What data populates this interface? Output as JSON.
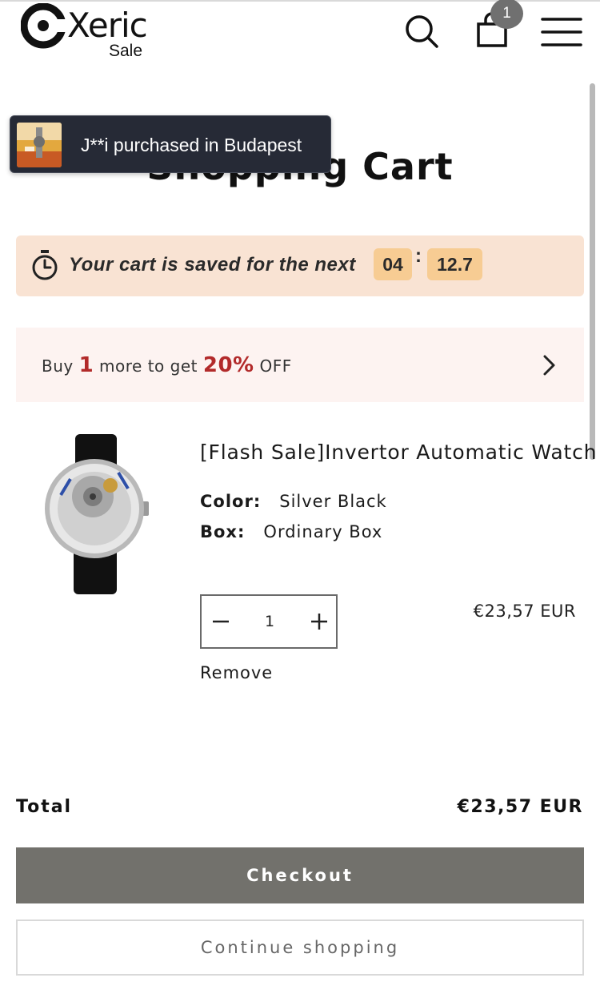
{
  "header": {
    "logo_text": "Xeric",
    "logo_sub": "Sale",
    "cart_count": "1"
  },
  "toast": {
    "text": "J**i purchased in Budapest"
  },
  "page": {
    "title": "Shopping Cart"
  },
  "timer": {
    "text": "Your cart is saved for the next",
    "minutes": "04",
    "separator": ":",
    "seconds": "12.7"
  },
  "promo": {
    "prefix": "Buy",
    "quantity": "1",
    "middle": "more to get",
    "discount": "20%",
    "suffix": "OFF"
  },
  "item": {
    "title": "[Flash Sale]Invertor Automatic Watch",
    "color_label": "Color:",
    "color_value": "Silver Black",
    "box_label": "Box:",
    "box_value": "Ordinary Box",
    "quantity": "1",
    "price": "€23,57 EUR",
    "remove_label": "Remove"
  },
  "summary": {
    "total_label": "Total",
    "total_value": "€23,57 EUR",
    "checkout_label": "Checkout",
    "continue_label": "Continue shopping"
  },
  "colors": {
    "timer_bg": "#f9e3d3",
    "timer_box": "#f7cc93",
    "promo_bg": "#fdf3f1",
    "promo_highlight": "#b22a2a",
    "checkout_bg": "#72716c",
    "toast_bg": "#262a36"
  }
}
